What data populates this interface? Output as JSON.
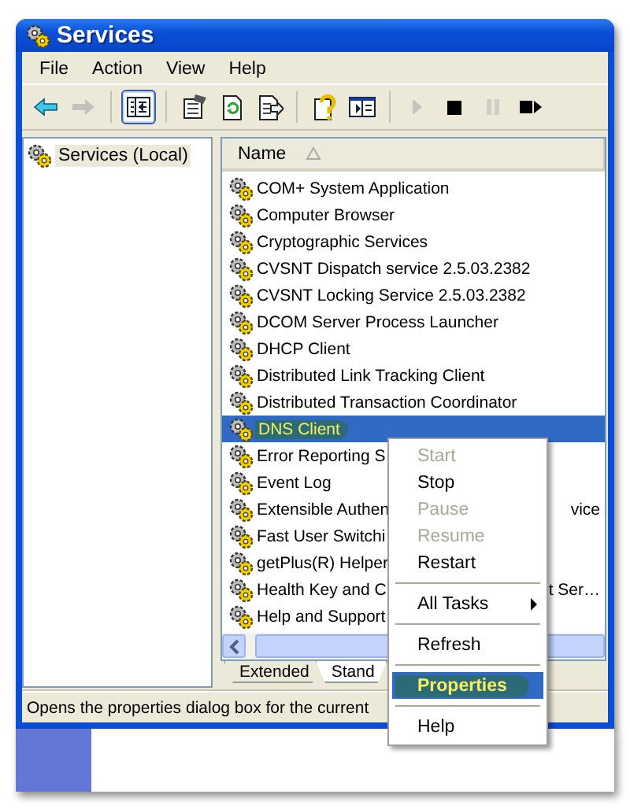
{
  "window": {
    "title": "Services"
  },
  "menu_bar": [
    "File",
    "Action",
    "View",
    "Help"
  ],
  "toolbar": [
    {
      "kind": "back",
      "disabled": false,
      "pressed": false
    },
    {
      "kind": "forward",
      "disabled": true,
      "pressed": false
    },
    {
      "kind": "separator"
    },
    {
      "kind": "tree",
      "disabled": false,
      "pressed": true
    },
    {
      "kind": "separator"
    },
    {
      "kind": "properties",
      "disabled": false,
      "pressed": false
    },
    {
      "kind": "refresh",
      "disabled": false,
      "pressed": false
    },
    {
      "kind": "export",
      "disabled": false,
      "pressed": false
    },
    {
      "kind": "separator"
    },
    {
      "kind": "help",
      "disabled": false,
      "pressed": false
    },
    {
      "kind": "panes",
      "disabled": false,
      "pressed": false
    },
    {
      "kind": "separator"
    },
    {
      "kind": "start",
      "disabled": true,
      "pressed": false
    },
    {
      "kind": "stop",
      "disabled": false,
      "pressed": false
    },
    {
      "kind": "pause",
      "disabled": true,
      "pressed": false
    },
    {
      "kind": "restart",
      "disabled": false,
      "pressed": false
    }
  ],
  "tree": [
    {
      "label": "Services (Local)",
      "selected": true
    }
  ],
  "table": {
    "columns": [
      {
        "label": "Name",
        "sort_ascending": true
      }
    ],
    "rows": [
      {
        "name": "COM+ System Application",
        "selected": false
      },
      {
        "name": "Computer Browser",
        "selected": false
      },
      {
        "name": "Cryptographic Services",
        "selected": false
      },
      {
        "name": "CVSNT Dispatch service 2.5.03.2382",
        "selected": false
      },
      {
        "name": "CVSNT Locking Service 2.5.03.2382",
        "selected": false
      },
      {
        "name": "DCOM Server Process Launcher",
        "selected": false
      },
      {
        "name": "DHCP Client",
        "selected": false
      },
      {
        "name": "Distributed Link Tracking Client",
        "selected": false
      },
      {
        "name": "Distributed Transaction Coordinator",
        "selected": false
      },
      {
        "name": "DNS Client",
        "selected": true
      },
      {
        "name": "Error Reporting S",
        "selected": false
      },
      {
        "name": "Event Log",
        "selected": false
      },
      {
        "name": "Extensible Authen",
        "tail": "vice",
        "selected": false
      },
      {
        "name": "Fast User Switchi",
        "selected": false
      },
      {
        "name": "getPlus(R) Helper",
        "selected": false
      },
      {
        "name": "Health Key and C",
        "tail": "t Ser…",
        "selected": false
      },
      {
        "name": "Help and Support",
        "selected": false
      }
    ]
  },
  "view_tabs": [
    {
      "label": "Extended",
      "selected": false
    },
    {
      "label": "Stand",
      "selected": true
    }
  ],
  "status_bar": "Opens the properties dialog box for the current",
  "context_menu": [
    {
      "kind": "item",
      "label": "Start",
      "disabled": true,
      "selected": false
    },
    {
      "kind": "item",
      "label": "Stop",
      "disabled": false,
      "selected": false
    },
    {
      "kind": "item",
      "label": "Pause",
      "disabled": true,
      "selected": false
    },
    {
      "kind": "item",
      "label": "Resume",
      "disabled": true,
      "selected": false
    },
    {
      "kind": "item",
      "label": "Restart",
      "disabled": false,
      "selected": false
    },
    {
      "kind": "separator"
    },
    {
      "kind": "submenu",
      "label": "All Tasks",
      "disabled": false,
      "selected": false
    },
    {
      "kind": "separator"
    },
    {
      "kind": "item",
      "label": "Refresh",
      "disabled": false,
      "selected": false
    },
    {
      "kind": "separator"
    },
    {
      "kind": "item",
      "label": "Properties",
      "disabled": false,
      "selected": true
    },
    {
      "kind": "separator"
    },
    {
      "kind": "item",
      "label": "Help",
      "disabled": false,
      "selected": false
    }
  ]
}
